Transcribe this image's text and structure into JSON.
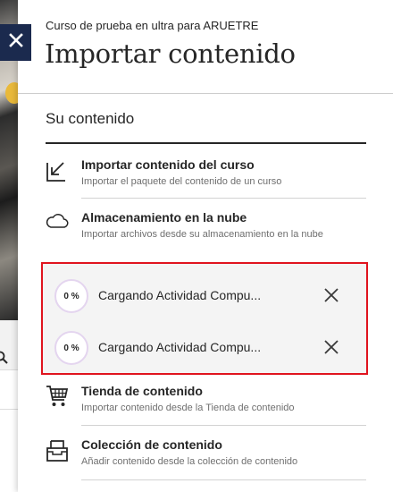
{
  "header": {
    "course_name": "Curso de prueba en ultra para ARUETRE",
    "title": "Importar contenido",
    "close_icon": "close-icon"
  },
  "section": {
    "title": "Su contenido"
  },
  "options": [
    {
      "icon": "import-arrow-icon",
      "title": "Importar contenido del curso",
      "description": "Importar el paquete del contenido de un curso"
    },
    {
      "icon": "cloud-icon",
      "title": "Almacenamiento en la nube",
      "description": "Importar archivos desde su almacenamiento en la nube"
    },
    {
      "icon": "cart-icon",
      "title": "Tienda de contenido",
      "description": "Importar contenido desde la Tienda de contenido"
    },
    {
      "icon": "collection-tray-icon",
      "title": "Colección de contenido",
      "description": "Añadir contenido desde la colección de contenido"
    }
  ],
  "uploads": [
    {
      "progress": 0,
      "progress_label": "0 %",
      "name": "Cargando Actividad Compu...",
      "cancel_icon": "close-icon"
    },
    {
      "progress": 0,
      "progress_label": "0 %",
      "name": "Cargando Actividad Compu...",
      "cancel_icon": "close-icon"
    }
  ],
  "colors": {
    "close_button_bg": "#1b2a4e",
    "highlight_border": "#e0141e",
    "progress_ring": "#e4d5ef"
  }
}
